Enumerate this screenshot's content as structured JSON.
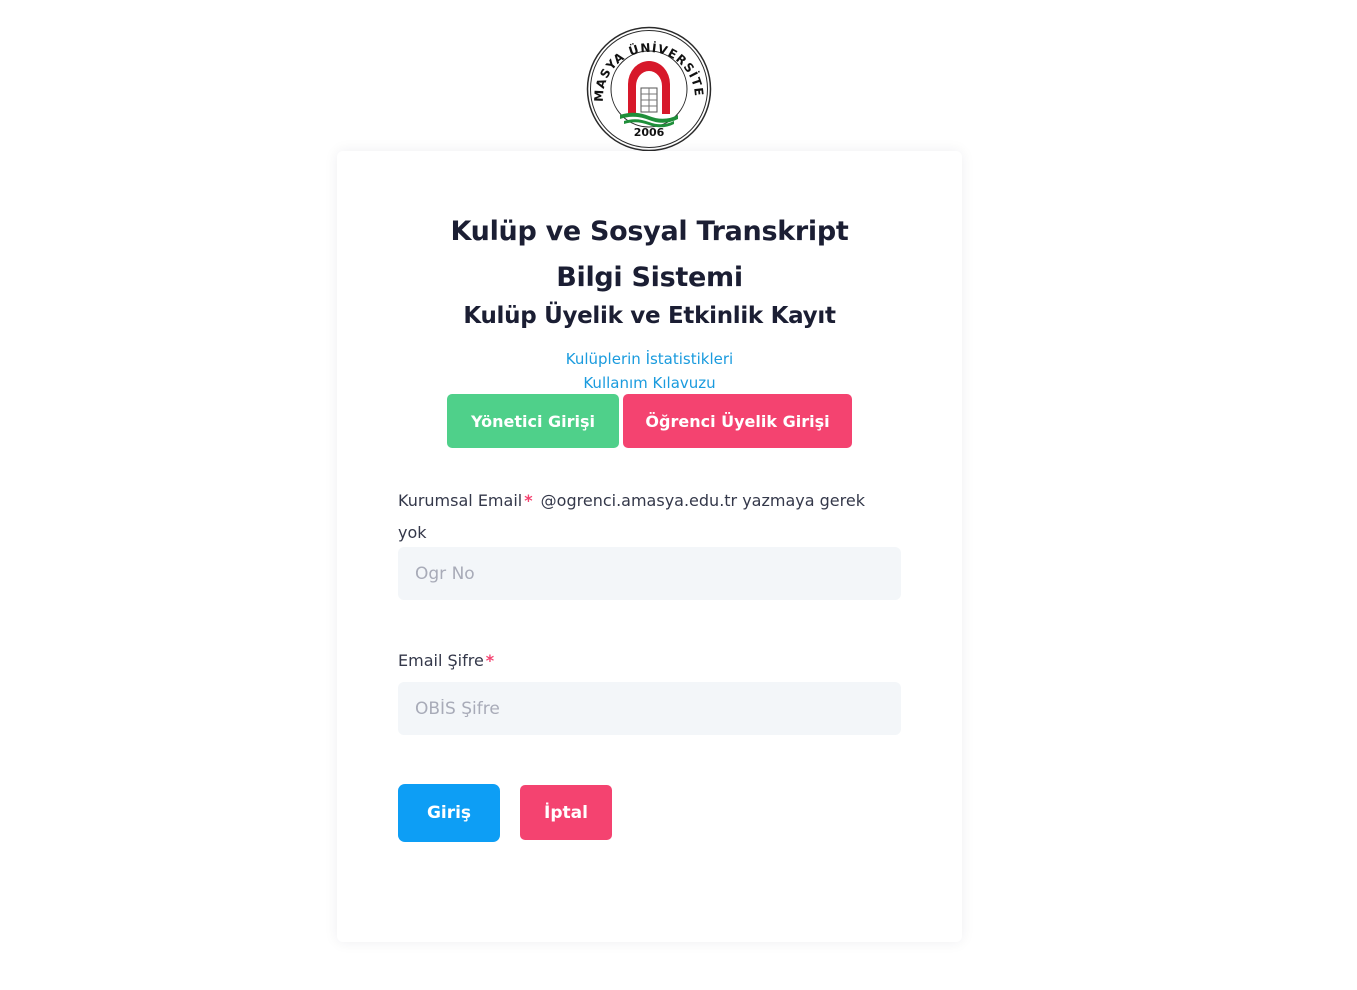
{
  "logo": {
    "ring_text": "AMASYA ÜNİVERSİTESİ",
    "year": "2006",
    "colors": {
      "red": "#d7182a",
      "green": "#1f8f3a",
      "ink": "#111111"
    }
  },
  "header": {
    "title_line1": "Kulüp ve Sosyal Transkript",
    "title_line2": "Bilgi Sistemi",
    "subtitle": "Kulüp Üyelik ve Etkinlik Kayıt"
  },
  "links": {
    "stats": "Kulüplerin İstatistikleri",
    "guide": "Kullanım Kılavuzu"
  },
  "role_buttons": {
    "admin": "Yönetici Girişi",
    "student": "Öğrenci Üyelik Girişi"
  },
  "form": {
    "email_label": "Kurumsal Email",
    "email_hint": "@ogrenci.amasya.edu.tr yazmaya gerek yok",
    "email_placeholder": "Ogr No",
    "password_label": "Email Şifre",
    "password_placeholder": "OBİS Şifre",
    "required_mark": "*"
  },
  "actions": {
    "login": "Giriş",
    "cancel": "İptal"
  },
  "colors": {
    "accent_blue": "#0d9ef5",
    "link_blue": "#1a9bde",
    "green": "#4fd08a",
    "pink": "#f44370",
    "input_bg": "#f3f6f9"
  }
}
